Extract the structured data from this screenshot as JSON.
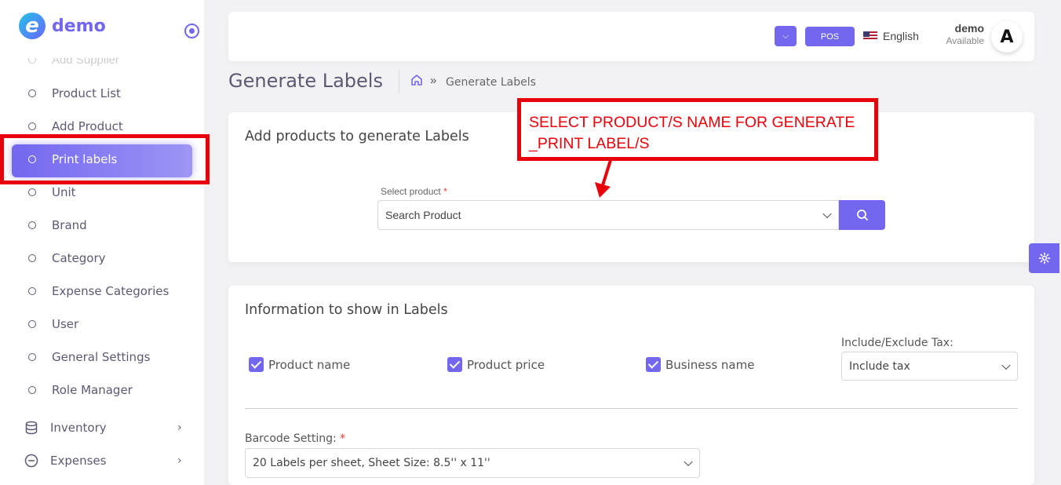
{
  "brand": {
    "logo_letter": "e",
    "name": "demo"
  },
  "sidebar": {
    "cut_item": "Add Supplier",
    "items": [
      {
        "label": "Product List",
        "active": false
      },
      {
        "label": "Add Product",
        "active": false
      },
      {
        "label": "Print labels",
        "active": true
      },
      {
        "label": "Unit",
        "active": false
      },
      {
        "label": "Brand",
        "active": false
      },
      {
        "label": "Category",
        "active": false
      },
      {
        "label": "Expense Categories",
        "active": false
      },
      {
        "label": "User",
        "active": false
      },
      {
        "label": "General Settings",
        "active": false
      },
      {
        "label": "Role Manager",
        "active": false
      }
    ],
    "groups": [
      {
        "label": "Inventory",
        "icon": "database-icon"
      },
      {
        "label": "Expenses",
        "icon": "minus-circle-icon"
      }
    ]
  },
  "header": {
    "pos_label": "POS",
    "language": "English",
    "user_name": "demo",
    "user_status": "Available",
    "avatar_letter": "A"
  },
  "page": {
    "title": "Generate Labels",
    "breadcrumb_current": "Generate Labels",
    "breadcrumb_separator": "»"
  },
  "add_products": {
    "title": "Add products to generate Labels",
    "select_label": "Select product",
    "required_mark": "*",
    "search_placeholder": "Search Product"
  },
  "info": {
    "title": "Information to show in Labels",
    "checkboxes": [
      {
        "label": "Product name",
        "checked": true
      },
      {
        "label": "Product price",
        "checked": true
      },
      {
        "label": "Business name",
        "checked": true
      }
    ],
    "tax_label": "Include/Exclude Tax:",
    "tax_value": "Include tax",
    "barcode_label": "Barcode Setting:",
    "barcode_value": "20 Labels per sheet, Sheet Size: 8.5'' x 11''"
  },
  "annotation": {
    "line1": "SELECT PRODUCT/S NAME FOR GENERATE",
    "line2": "_PRINT LABEL/S"
  },
  "colors": {
    "accent": "#7367f0",
    "annotation_red": "#e8000b"
  }
}
